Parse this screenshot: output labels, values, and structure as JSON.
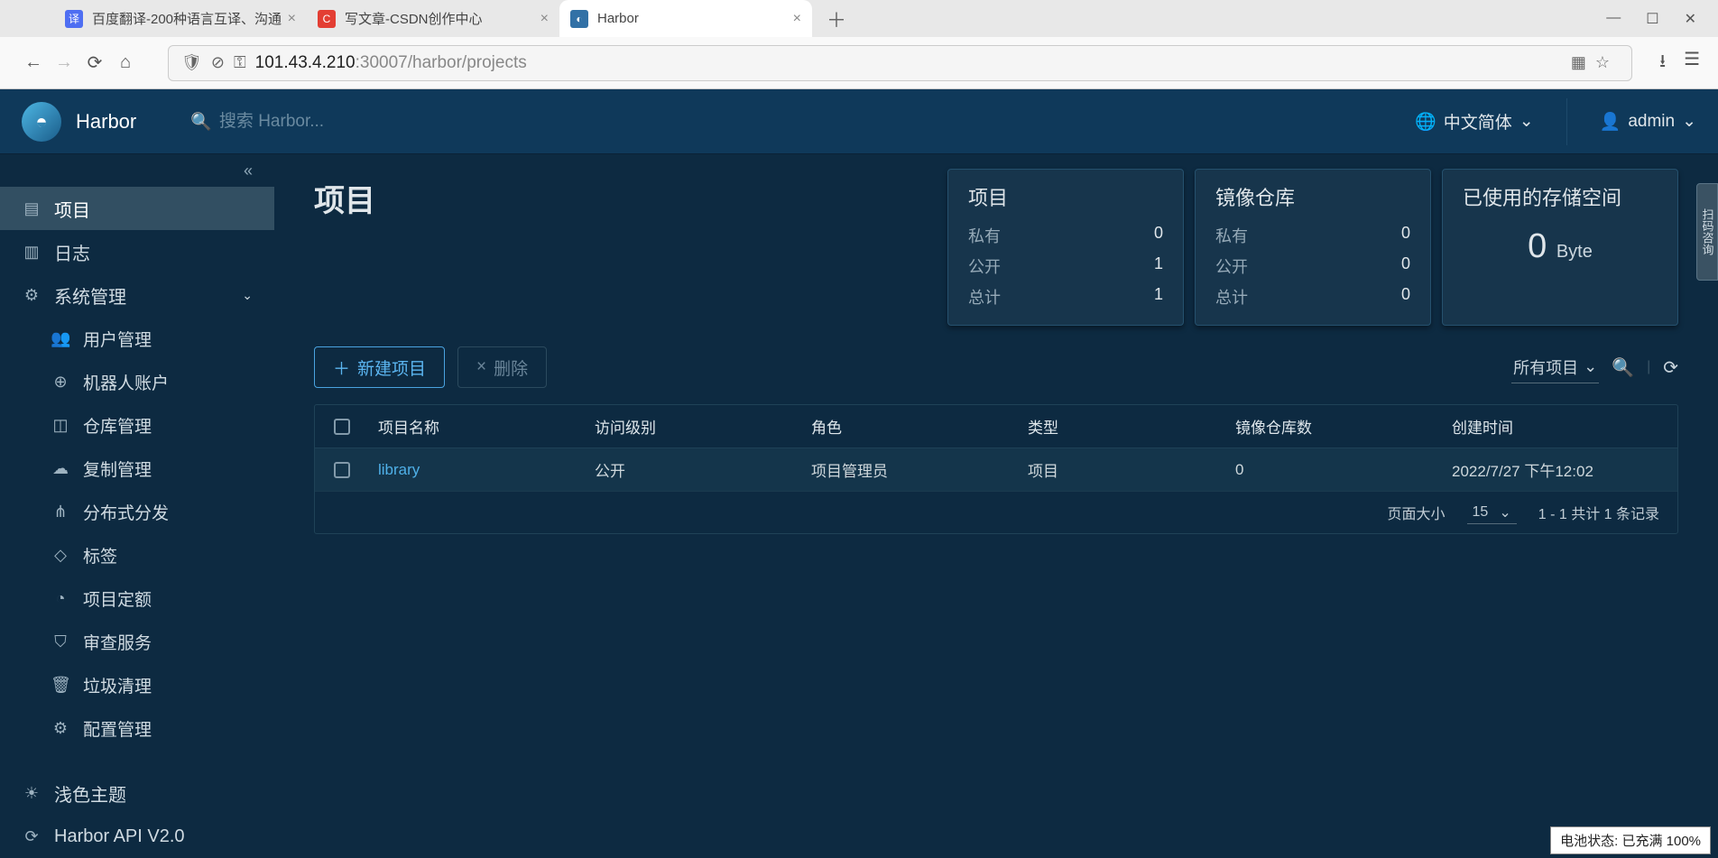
{
  "browser": {
    "tabs": [
      {
        "title": "百度翻译-200种语言互译、沟通"
      },
      {
        "title": "写文章-CSDN创作中心"
      },
      {
        "title": "Harbor"
      }
    ],
    "url_host": "101.43.4.210",
    "url_port": ":30007",
    "url_path": "/harbor/projects"
  },
  "header": {
    "brand": "Harbor",
    "search_placeholder": "搜索 Harbor...",
    "language": "中文简体",
    "user": "admin"
  },
  "sidebar": {
    "items": [
      {
        "label": "项目"
      },
      {
        "label": "日志"
      },
      {
        "label": "系统管理"
      },
      {
        "label": "用户管理"
      },
      {
        "label": "机器人账户"
      },
      {
        "label": "仓库管理"
      },
      {
        "label": "复制管理"
      },
      {
        "label": "分布式分发"
      },
      {
        "label": "标签"
      },
      {
        "label": "项目定额"
      },
      {
        "label": "审查服务"
      },
      {
        "label": "垃圾清理"
      },
      {
        "label": "配置管理"
      }
    ],
    "theme_label": "浅色主题",
    "api_label": "Harbor API V2.0"
  },
  "page": {
    "title": "项目",
    "stats": {
      "projects": {
        "title": "项目",
        "rows": [
          {
            "k": "私有",
            "v": "0"
          },
          {
            "k": "公开",
            "v": "1"
          },
          {
            "k": "总计",
            "v": "1"
          }
        ]
      },
      "repos": {
        "title": "镜像仓库",
        "rows": [
          {
            "k": "私有",
            "v": "0"
          },
          {
            "k": "公开",
            "v": "0"
          },
          {
            "k": "总计",
            "v": "0"
          }
        ]
      },
      "storage": {
        "title": "已使用的存储空间",
        "value": "0",
        "unit": "Byte"
      }
    },
    "actions": {
      "new": "新建项目",
      "delete": "删除",
      "filter": "所有项目"
    },
    "table": {
      "columns": [
        "项目名称",
        "访问级别",
        "角色",
        "类型",
        "镜像仓库数",
        "创建时间"
      ],
      "rows": [
        {
          "name": "library",
          "access": "公开",
          "role": "项目管理员",
          "type": "项目",
          "repos": "0",
          "created": "2022/7/27 下午12:02"
        }
      ],
      "footer": {
        "page_size_label": "页面大小",
        "page_size": "15",
        "range": "1 - 1 共计 1 条记录"
      }
    }
  },
  "tooltip": "电池状态: 已充满 100%"
}
